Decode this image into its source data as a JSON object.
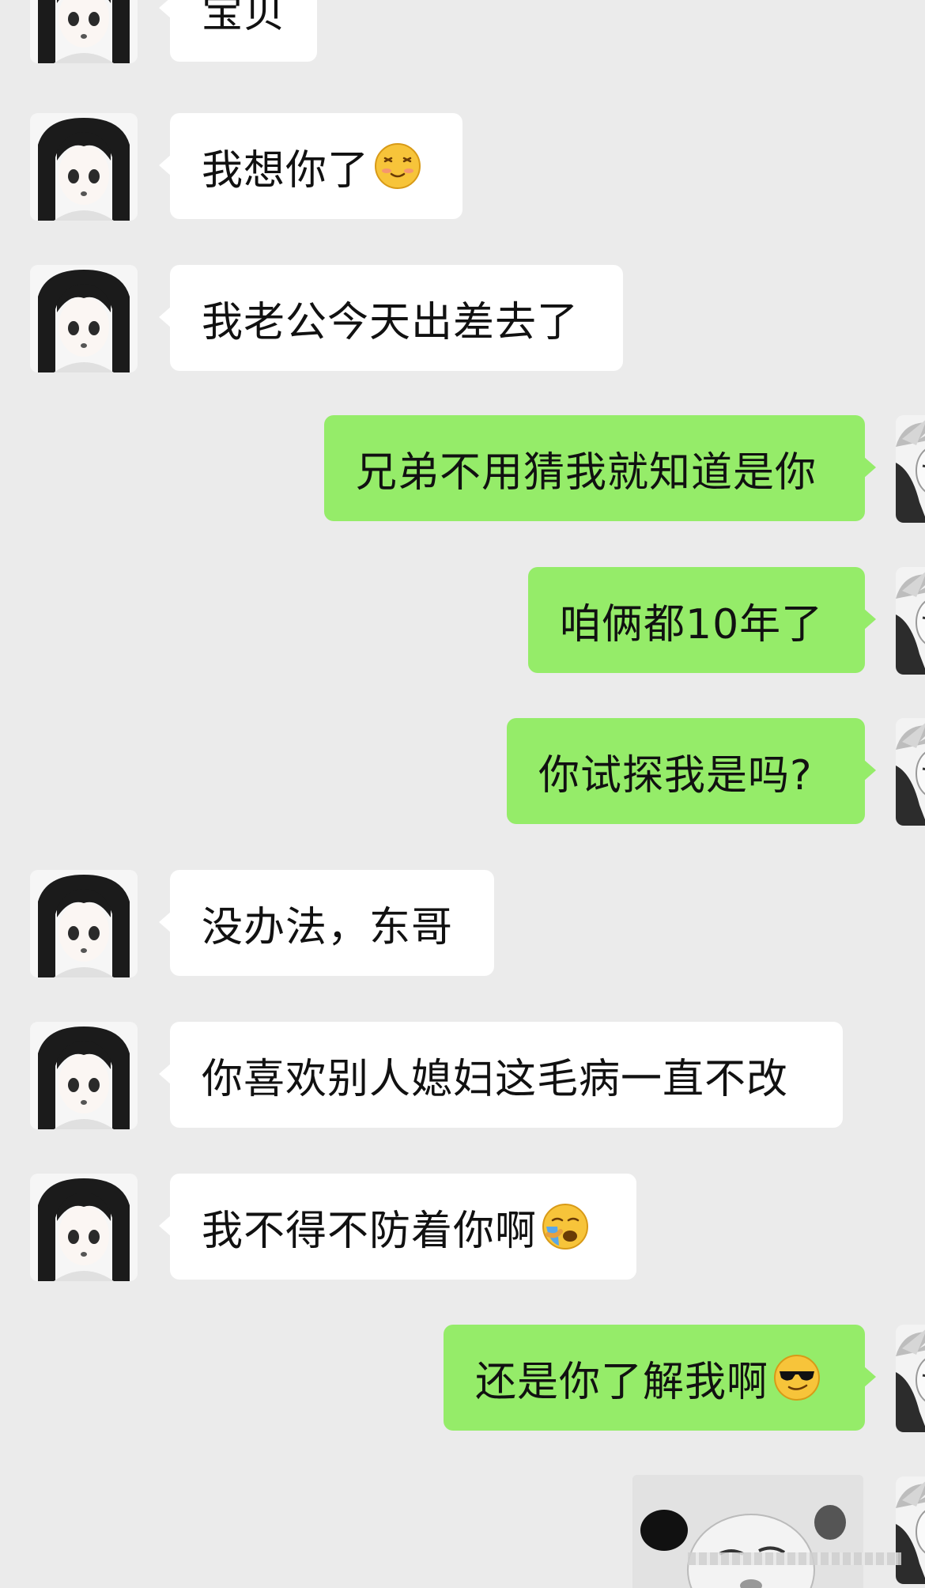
{
  "messages": [
    {
      "side": "in",
      "text": "宝贝",
      "emoji": ""
    },
    {
      "side": "in",
      "text": "我想你了",
      "emoji": "blush-emoji"
    },
    {
      "side": "in",
      "text": "我老公今天出差去了",
      "emoji": ""
    },
    {
      "side": "out",
      "text": "兄弟不用猜我就知道是你",
      "emoji": ""
    },
    {
      "side": "out",
      "text": "咱俩都10年了",
      "emoji": ""
    },
    {
      "side": "out",
      "text": "你试探我是吗?",
      "emoji": ""
    },
    {
      "side": "in",
      "text": "没办法，东哥",
      "emoji": ""
    },
    {
      "side": "in",
      "text": "你喜欢别人媳妇这毛病一直不改",
      "emoji": ""
    },
    {
      "side": "in",
      "text": "我不得不防着你啊",
      "emoji": "crying-emoji"
    },
    {
      "side": "out",
      "text": "还是你了解我啊",
      "emoji": "sunglasses-emoji"
    }
  ],
  "colors": {
    "background": "#ebebeb",
    "incoming_bubble": "#ffffff",
    "outgoing_bubble": "#95ec69"
  }
}
